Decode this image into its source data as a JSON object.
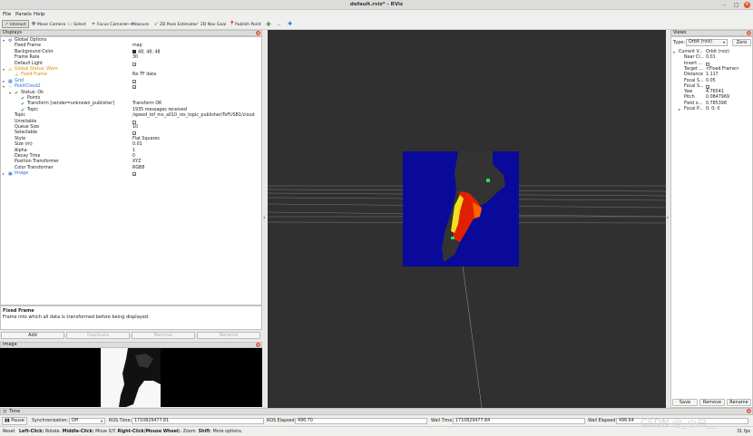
{
  "window": {
    "title": "default.rviz* - RViz"
  },
  "menu": [
    "File",
    "Panels",
    "Help"
  ],
  "toolbar": [
    {
      "label": "Interact",
      "icon": "interact-icon",
      "active": true
    },
    {
      "label": "Move Camera",
      "icon": "move-camera-icon"
    },
    {
      "label": "Select",
      "icon": "select-icon"
    },
    {
      "label": "Focus Camera",
      "icon": "focus-camera-icon"
    },
    {
      "label": "Measure",
      "icon": "measure-icon"
    },
    {
      "label": "2D Pose Estimate",
      "icon": "pose-estimate-icon"
    },
    {
      "label": "2D Nav Goal",
      "icon": "nav-goal-icon"
    },
    {
      "label": "Publish Point",
      "icon": "publish-point-icon"
    }
  ],
  "displays": {
    "header": "Displays",
    "rows": [
      {
        "label": "Global Options",
        "depth": 0,
        "caret": "▾",
        "icon": "gear"
      },
      {
        "label": "Fixed Frame",
        "depth": 1,
        "value": "map"
      },
      {
        "label": "Background Color",
        "depth": 1,
        "value": "48; 48; 48",
        "swatch": "#303030"
      },
      {
        "label": "Frame Rate",
        "depth": 1,
        "value": "30"
      },
      {
        "label": "Default Light",
        "depth": 1,
        "check": true
      },
      {
        "label": "Global Status: Warn",
        "depth": 0,
        "caret": "▾",
        "icon": "warn",
        "color": "#d88c00"
      },
      {
        "label": "Fixed Frame",
        "depth": 1,
        "value": "No TF data",
        "icon": "warn",
        "color": "#d88c00"
      },
      {
        "label": "Grid",
        "depth": 0,
        "caret": "▸",
        "icon": "grid",
        "check": true,
        "color": "#1b6fd1"
      },
      {
        "label": "PointCloud2",
        "depth": 0,
        "caret": "▾",
        "icon": "cloud",
        "check": true,
        "color": "#1b6fd1"
      },
      {
        "label": "Status: Ok",
        "depth": 1,
        "caret": "▾",
        "icon": "ok"
      },
      {
        "label": "Points",
        "depth": 2,
        "icon": "ok"
      },
      {
        "label": "Transform [sender=unknown_publisher]",
        "depth": 2,
        "icon": "ok",
        "value": "Transform OK"
      },
      {
        "label": "Topic",
        "depth": 2,
        "icon": "ok",
        "value": "1935 messages received"
      },
      {
        "label": "Topic",
        "depth": 1,
        "value": "/speed_tof_ms_a010_ros_topic_publisher/ToFUSB1/cloud"
      },
      {
        "label": "Unreliable",
        "depth": 1,
        "check": false
      },
      {
        "label": "Queue Size",
        "depth": 1,
        "value": "10"
      },
      {
        "label": "Selectable",
        "depth": 1,
        "check": true
      },
      {
        "label": "Style",
        "depth": 1,
        "value": "Flat Squares"
      },
      {
        "label": "Size (m)",
        "depth": 1,
        "value": "0.01"
      },
      {
        "label": "Alpha",
        "depth": 1,
        "value": "1"
      },
      {
        "label": "Decay Time",
        "depth": 1,
        "value": "0"
      },
      {
        "label": "Position Transformer",
        "depth": 1,
        "value": "XYZ"
      },
      {
        "label": "Color Transformer",
        "depth": 1,
        "value": "RGB8"
      },
      {
        "label": "Image",
        "depth": 0,
        "caret": "▸",
        "icon": "image",
        "check": true,
        "color": "#1b6fd1"
      }
    ]
  },
  "description": {
    "title": "Fixed Frame",
    "body": "Frame into which all data is transformed before being displayed."
  },
  "buttons": {
    "add": "Add",
    "duplicate": "Duplicate",
    "remove": "Remove",
    "rename": "Rename"
  },
  "image_panel": {
    "header": "Image"
  },
  "views": {
    "header": "Views",
    "type_label": "Type:",
    "type_value": "Orbit (rviz)",
    "zero": "Zero",
    "rows": [
      {
        "label": "Current V...",
        "value": "Orbit (rviz)",
        "caret": "▾",
        "depth": 0
      },
      {
        "label": "Near Cl...",
        "value": "0.01",
        "depth": 1
      },
      {
        "label": "Invert ...",
        "check": false,
        "depth": 1
      },
      {
        "label": "Target ...",
        "value": "<Fixed Frame>",
        "depth": 1
      },
      {
        "label": "Distance",
        "value": "1.117",
        "depth": 1
      },
      {
        "label": "Focal S...",
        "value": "0.05",
        "depth": 1
      },
      {
        "label": "Focal S...",
        "check": true,
        "depth": 1
      },
      {
        "label": "Yaw",
        "value": "4.76541",
        "depth": 1
      },
      {
        "label": "Pitch",
        "value": "0.0847969",
        "depth": 1
      },
      {
        "label": "Field o...",
        "value": "0.785398",
        "depth": 1
      },
      {
        "label": "Focal P...",
        "value": "0; 0; 0",
        "caret": "▸",
        "depth": 1
      }
    ],
    "save": "Save",
    "remove": "Remove",
    "rename": "Rename"
  },
  "time": {
    "header": "Time",
    "pause": "Pause",
    "sync_label": "Synchronization:",
    "sync_value": "Off",
    "ros_time_label": "ROS Time:",
    "ros_time": "1710829477.81",
    "ros_elapsed_label": "ROS Elapsed:",
    "ros_elapsed": "496.70",
    "wall_time_label": "Wall Time:",
    "wall_time": "1710829477.84",
    "wall_elapsed_label": "Wall Elapsed:",
    "wall_elapsed": "496.64"
  },
  "status": {
    "reset": "Reset",
    "hint_a": "Left-Click:",
    "hint_a_text": " Rotate. ",
    "hint_b": "Middle-Click:",
    "hint_b_text": " Move X/Y. ",
    "hint_c": "Right-Click/Mouse Wheel:",
    "hint_c_text": ": Zoom. ",
    "hint_d": "Shift",
    "hint_d_text": ": More options.",
    "fps": "31 fps"
  },
  "watermark": "CSDN @_小白__"
}
